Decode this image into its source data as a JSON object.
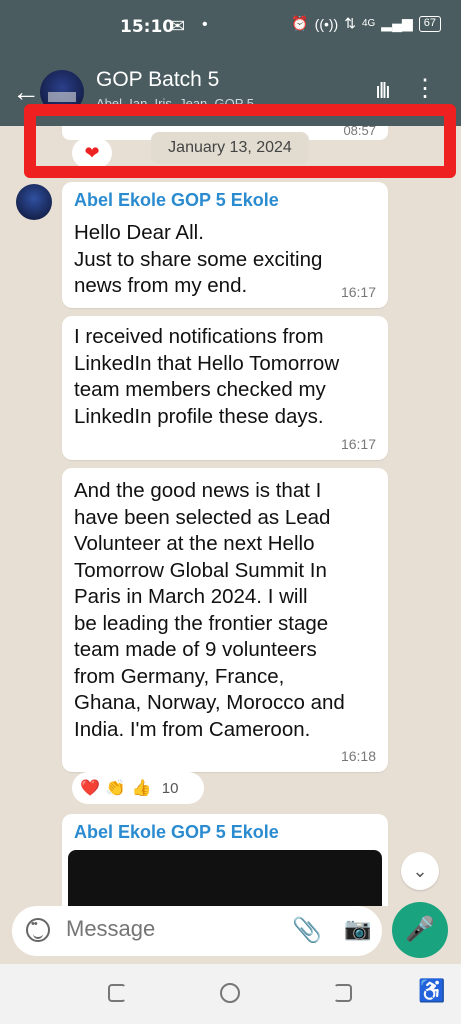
{
  "status_bar": {
    "time": "15:10",
    "battery": "67",
    "network": "4G"
  },
  "header": {
    "group_name": "GOP Batch 5",
    "subtitle": "Abel, Ian, Iris, Jean, GOP 5..."
  },
  "chat": {
    "previous_time": "08:57",
    "date_chip": "January 13, 2024",
    "messages": [
      {
        "sender": "Abel Ekole GOP 5 Ekole",
        "text": "Hello Dear All.\nJust to share some exciting\nnews from my end.",
        "time": "16:17"
      },
      {
        "text": "I received notifications from\nLinkedIn that Hello Tomorrow\nteam members checked my\nLinkedIn profile these days.",
        "time": "16:17"
      },
      {
        "text": "And the good news is that I\nhave been selected as Lead\nVolunteer at the next Hello\nTomorrow Global Summit In\nParis in March 2024. I will\nbe leading the frontier stage\nteam made of 9 volunteers\nfrom Germany, France,\nGhana, Norway, Morocco and\nIndia. I'm from Cameroon.",
        "time": "16:18"
      },
      {
        "sender": "Abel Ekole GOP 5 Ekole"
      }
    ],
    "reactions": {
      "emojis": [
        "❤️",
        "👏",
        "👍"
      ],
      "count": "10"
    }
  },
  "composer": {
    "placeholder": "Message"
  }
}
